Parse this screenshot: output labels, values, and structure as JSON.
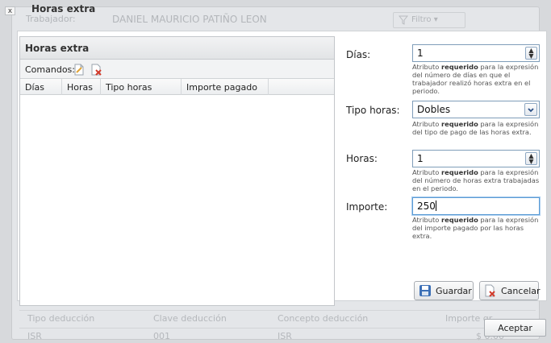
{
  "background": {
    "employee_label": "Trabajador:",
    "employee_name": "DANIEL MAURICIO PATIÑO LEON",
    "filter_label": "Filtro",
    "deductions_table": {
      "headers": [
        "Tipo deducción",
        "Clave deducción",
        "Concepto deducción",
        "Importe gr..."
      ],
      "rows": [
        [
          "ISR",
          "001",
          "ISR",
          "$ 0.00"
        ]
      ]
    }
  },
  "dialog": {
    "close_glyph": "x",
    "title": "Horas extra",
    "grid": {
      "header": "Horas extra",
      "commands_label": "Comandos:",
      "columns": [
        "Días",
        "Horas",
        "Tipo horas",
        "Importe pagado"
      ]
    },
    "form": {
      "dias": {
        "label": "Días:",
        "value": "1",
        "hint_pre": "Atributo ",
        "hint_bold": "requerido",
        "hint_post": " para la expresión del número de días en que el trabajador realizó horas extra en el periodo."
      },
      "tipo_horas": {
        "label": "Tipo horas:",
        "value": "Dobles",
        "hint_pre": "Atributo ",
        "hint_bold": "requerido",
        "hint_post": " para la expresión del tipo de pago de las horas extra."
      },
      "horas": {
        "label": "Horas:",
        "value": "1",
        "hint_pre": "Atributo ",
        "hint_bold": "requerido",
        "hint_post": " para la expresión del número de horas extra trabajadas en el periodo."
      },
      "importe": {
        "label": "Importe:",
        "value": "250",
        "hint_pre": "Atributo ",
        "hint_bold": "requerido",
        "hint_post": " para la expresión del importe pagado por las horas extra."
      }
    },
    "buttons": {
      "save": "Guardar",
      "cancel": "Cancelar",
      "accept": "Aceptar"
    }
  },
  "colors": {
    "save_icon": "#3b6fb6",
    "delete_icon": "#d23a2a",
    "field_border": "#7f9db9"
  }
}
